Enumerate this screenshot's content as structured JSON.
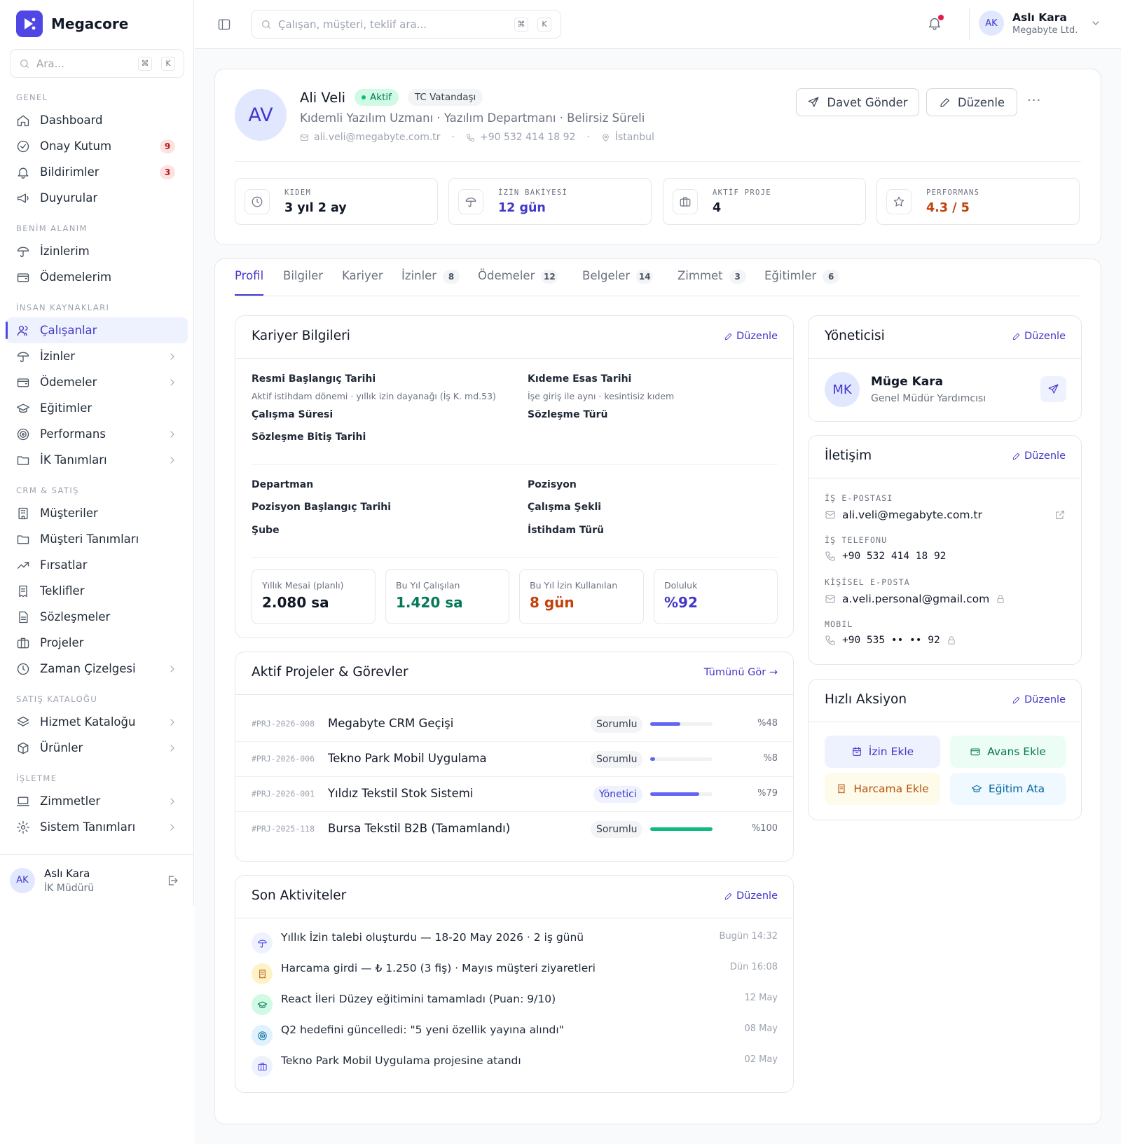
{
  "brand": {
    "name": "Megacore"
  },
  "sidebar": {
    "search_placeholder": "Ara...",
    "kbd": [
      "⌘",
      "K"
    ],
    "sections": {
      "genel": "GENEL",
      "benim": "BENİM ALANIM",
      "ik": "İNSAN KAYNAKLARI",
      "crm": "CRM & SATIŞ",
      "katalog": "SATIŞ KATALOĞU",
      "isletme": "İŞLETME"
    },
    "items": {
      "dashboard": "Dashboard",
      "onay": "Onay Kutum",
      "onay_count": "9",
      "bildirim": "Bildirimler",
      "bildirim_count": "3",
      "duyuru": "Duyurular",
      "izinlerim": "İzinlerim",
      "odemelerim": "Ödemelerim",
      "calisanlar": "Çalışanlar",
      "izinler": "İzinler",
      "odemeler": "Ödemeler",
      "egitimler": "Eğitimler",
      "performans": "Performans",
      "ik_tanim": "İK Tanımları",
      "musteriler": "Müşteriler",
      "musteri_tanim": "Müşteri Tanımları",
      "firsatlar": "Fırsatlar",
      "teklifler": "Teklifler",
      "sozlesmeler": "Sözleşmeler",
      "projeler": "Projeler",
      "zaman": "Zaman Çizelgesi",
      "hizmet": "Hizmet Kataloğu",
      "urunler": "Ürünler",
      "zimmetler": "Zimmetler",
      "sistem": "Sistem Tanımları"
    },
    "user": {
      "initials": "AK",
      "name": "Aslı Kara",
      "role": "İK Müdürü"
    }
  },
  "topbar": {
    "search_placeholder": "Çalışan, müşteri, teklif ara...",
    "kbd": [
      "⌘",
      "K"
    ],
    "user": {
      "initials": "AK",
      "name": "Aslı Kara",
      "company": "Megabyte Ltd."
    }
  },
  "profile": {
    "initials": "AV",
    "name": "Ali Veli",
    "status": "Aktif",
    "citizenship": "TC Vatandaşı",
    "subtitle": "Kıdemli Yazılım Uzmanı · Yazılım Departmanı · Belirsiz Süreli",
    "email": "ali.veli@megabyte.com.tr",
    "phone": "+90 532 414 18 92",
    "city": "İstanbul",
    "invite_label": "Davet Gönder",
    "edit_label": "Düzenle",
    "more": "···",
    "stats": [
      {
        "label": "KIDEM",
        "value": "3 yıl 2 ay",
        "color": "#111827"
      },
      {
        "label": "İZİN BAKİYESİ",
        "value": "12 gün",
        "color": "#4338ca"
      },
      {
        "label": "AKTİF PROJE",
        "value": "4",
        "color": "#111827"
      },
      {
        "label": "PERFORMANS",
        "value": "4.3 / 5",
        "color": "#c2410c"
      }
    ]
  },
  "tabs": [
    {
      "label": "Profil"
    },
    {
      "label": "Bilgiler"
    },
    {
      "label": "Kariyer"
    },
    {
      "label": "İzinler",
      "count": "8"
    },
    {
      "label": "Ödemeler",
      "count": "12"
    },
    {
      "label": "Belgeler",
      "count": "14"
    },
    {
      "label": "Zimmet",
      "count": "3"
    },
    {
      "label": "Eğitimler",
      "count": "6"
    }
  ],
  "career": {
    "title": "Kariyer Bilgileri",
    "edit": "Düzenle",
    "resmi": "Resmi Başlangıç Tarihi",
    "resmi_sub": "Aktif istihdam dönemi · yıllık izin dayanağı (İş K. md.53)",
    "kidem": "Kıdeme Esas Tarihi",
    "kidem_sub": "İşe giriş ile aynı · kesintisiz kıdem",
    "calisma_suresi": "Çalışma Süresi",
    "sozlesme_turu": "Sözleşme Türü",
    "sozlesme_bitis": "Sözleşme Bitiş Tarihi",
    "departman": "Departman",
    "pozisyon": "Pozisyon",
    "poz_baslangic": "Pozisyon Başlangıç Tarihi",
    "calisma_sekli": "Çalışma Şekli",
    "sube": "Şube",
    "istihdam": "İstihdam Türü",
    "minis": [
      {
        "label": "Yıllık Mesai (planlı)",
        "value": "2.080 sa",
        "color": "#111827"
      },
      {
        "label": "Bu Yıl Çalışılan",
        "value": "1.420 sa",
        "color": "#047857"
      },
      {
        "label": "Bu Yıl İzin Kullanılan",
        "value": "8 gün",
        "color": "#c2410c"
      },
      {
        "label": "Doluluk",
        "value": "%92",
        "color": "#4338ca"
      }
    ]
  },
  "projects": {
    "title": "Aktif Projeler & Görevler",
    "see_all": "Tümünü Gör →",
    "rows": [
      {
        "id": "#PRJ-2026-008",
        "name": "Megabyte CRM Geçişi",
        "role": "Sorumlu",
        "progress": 48,
        "pct": "%48",
        "color": "#6366f1"
      },
      {
        "id": "#PRJ-2026-006",
        "name": "Tekno Park Mobil Uygulama",
        "role": "Sorumlu",
        "progress": 8,
        "pct": "%8",
        "color": "#6366f1"
      },
      {
        "id": "#PRJ-2026-001",
        "name": "Yıldız Tekstil Stok Sistemi",
        "role": "Yönetici",
        "progress": 79,
        "pct": "%79",
        "color": "#6366f1"
      },
      {
        "id": "#PRJ-2025-118",
        "name": "Bursa Tekstil B2B (Tamamlandı)",
        "role": "Sorumlu",
        "progress": 100,
        "pct": "%100",
        "color": "#10b981"
      }
    ]
  },
  "activity": {
    "title": "Son Aktiviteler",
    "edit": "Düzenle",
    "rows": [
      {
        "text": "Yıllık İzin talebi oluşturdu — 18-20 May 2026 · 2 iş günü",
        "time": "Bugün 14:32",
        "icon": "umbrella-icon"
      },
      {
        "text": "Harcama girdi — ₺ 1.250 (3 fiş) · Mayıs müşteri ziyaretleri",
        "time": "Dün 16:08",
        "icon": "receipt-icon"
      },
      {
        "text": "React İleri Düzey eğitimini tamamladı (Puan: 9/10)",
        "time": "12 May",
        "icon": "graduation-icon"
      },
      {
        "text": "Q2 hedefini güncelledi: \"5 yeni özellik yayına alındı\"",
        "time": "08 May",
        "icon": "target-icon"
      },
      {
        "text": "Tekno Park Mobil Uygulama projesine atandı",
        "time": "02 May",
        "icon": "briefcase-icon"
      }
    ]
  },
  "manager": {
    "title": "Yöneticisi",
    "edit": "Düzenle",
    "initials": "MK",
    "name": "Müge Kara",
    "role": "Genel Müdür Yardımcısı"
  },
  "contact": {
    "title": "İletişim",
    "edit": "Düzenle",
    "work_email_label": "İŞ E-POSTASI",
    "work_email": "ali.veli@megabyte.com.tr",
    "work_phone_label": "İŞ TELEFONU",
    "work_phone": "+90 532 414 18 92",
    "personal_email_label": "KİŞİSEL E-POSTA",
    "personal_email": "a.veli.personal@gmail.com",
    "mobile_label": "MOBIL",
    "mobile": "+90 535 •• •• 92"
  },
  "quick": {
    "title": "Hızlı Aksiyon",
    "edit": "Düzenle",
    "izin": "İzin Ekle",
    "avans": "Avans Ekle",
    "harcama": "Harcama Ekle",
    "egitim": "Eğitim Ata"
  }
}
